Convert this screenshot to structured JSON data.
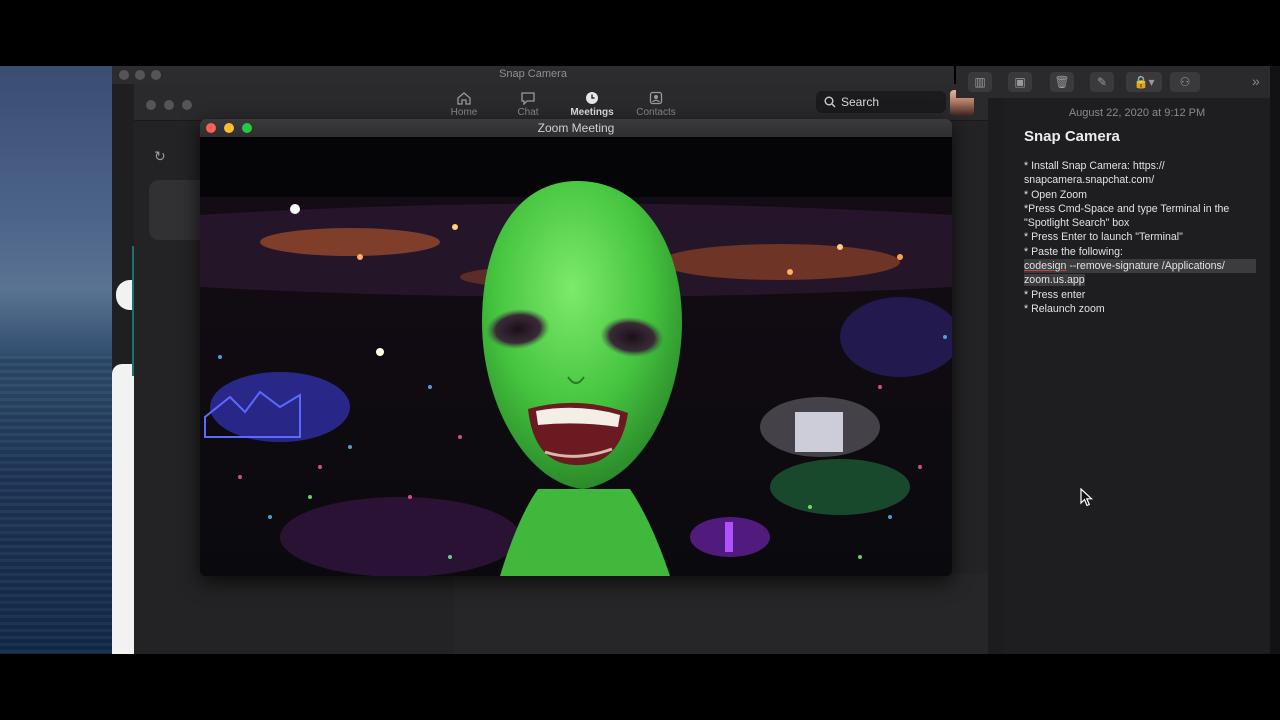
{
  "snap_camera": {
    "title": "Snap Camera"
  },
  "zoom": {
    "nav": [
      {
        "label": "Home",
        "icon": "home-icon"
      },
      {
        "label": "Chat",
        "icon": "chat-icon"
      },
      {
        "label": "Meetings",
        "icon": "clock-icon"
      },
      {
        "label": "Contacts",
        "icon": "contacts-icon"
      }
    ],
    "search_label": "Search",
    "refresh_icon": "refresh-icon"
  },
  "meeting": {
    "title": "Zoom Meeting"
  },
  "notes": {
    "date": "August 22, 2020 at 9:12 PM",
    "title": "Snap Camera",
    "lines": [
      "* Install Snap Camera: https://",
      "snapcamera.snapchat.com/",
      "* Open Zoom",
      "*Press Cmd-Space and type Terminal in the",
      "\"Spotlight Search\" box",
      "* Press Enter to launch \"Terminal\"",
      "* Paste the following:",
      "codesign",
      " --remove-signature /Applications/",
      "zoom.us.app",
      "* Press enter",
      "* Relaunch zoom"
    ],
    "toolbar_icons": [
      "sidebar-icon",
      "gallery-icon",
      "trash-icon",
      "compose-icon",
      "lock-icon",
      "share-icon",
      "more-icon"
    ]
  },
  "colors": {
    "traffic_red": "#ff5f57",
    "traffic_yellow": "#febc2e",
    "traffic_green": "#28c840",
    "alien_green": "#4fd24a"
  }
}
